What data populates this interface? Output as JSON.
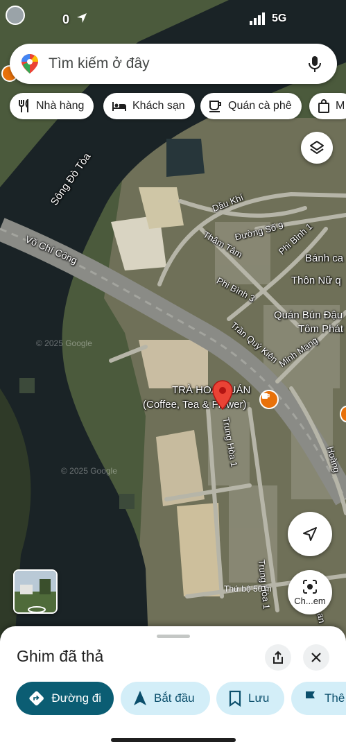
{
  "status_bar": {
    "time": "0",
    "network": "5G"
  },
  "search": {
    "placeholder": "Tìm kiếm ở đây"
  },
  "chips": [
    {
      "label": "Nhà hàng",
      "icon": "fork-knife-icon"
    },
    {
      "label": "Khách sạn",
      "icon": "bed-icon"
    },
    {
      "label": "Quán cà phê",
      "icon": "coffee-cup-icon"
    },
    {
      "label": "M",
      "icon": "shopping-bag-icon"
    }
  ],
  "map": {
    "labels": {
      "river": "Sông Đò Tòa",
      "vo_chi_cong": "Võ Chí Công",
      "dau_khi": "Dầu Khí",
      "duong_so_9": "Đường Số 9",
      "tham_tam": "Thâm Tâm",
      "phi_binh_1": "Phi Bình 1",
      "banh_ca": "Bánh ca",
      "thon_nu": "Thôn Nữ q",
      "phi_binh_3": "Phi Bình 3",
      "quan_bun": "Quán Bún Đậu",
      "tom_phat": "Tôm Phát",
      "tran_quy_kien": "Trần Quý Kiên",
      "minh_mang": "Minh Mạng",
      "poi_name": "TRÀ HOA QUÁN",
      "poi_sub": "(Coffee, Tea & Flower)",
      "trung_hoa_1a": "Trung Hòa 1",
      "trung_hoa_1b": "Trung Hòa 1",
      "hoang": "Hoàng",
      "lan": "Lan"
    },
    "watermark_1": "© 2025 Google",
    "watermark_2": "© 2025 Google",
    "scale": "Thứ bộ 50 m"
  },
  "lens_label": "Ch...em",
  "sheet": {
    "title": "Ghim đã thả",
    "actions": {
      "directions": "Đường đi",
      "start": "Bắt đầu",
      "save": "Lưu",
      "share": "Thê"
    }
  },
  "colors": {
    "primary": "#0b5d73",
    "chip_bg": "#d3eef8",
    "pin": "#ea4335",
    "coffee": "#e8710a"
  }
}
